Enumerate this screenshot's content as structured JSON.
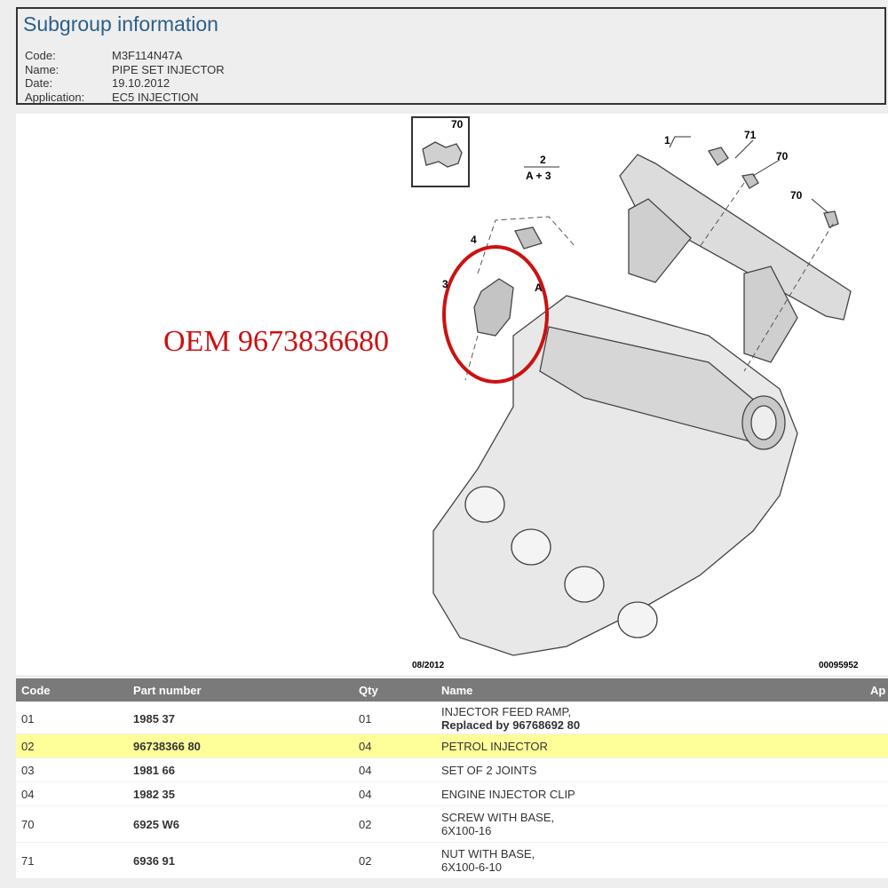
{
  "subgroup": {
    "title": "Subgroup information",
    "fields": [
      {
        "label": "Code:",
        "value": "M3F114N47A"
      },
      {
        "label": "Name:",
        "value": "PIPE SET INJECTOR"
      },
      {
        "label": "Date:",
        "value": "19.10.2012"
      },
      {
        "label": "Application:",
        "value": "EC5 INJECTION"
      }
    ]
  },
  "diagram": {
    "date_label": "08/2012",
    "ref_label": "00095952",
    "oem_annotation": "OEM 9673836680",
    "callouts": {
      "c1": "1",
      "c2": "2",
      "c2b": "A + 3",
      "c3": "3",
      "c4": "4",
      "cA": "A",
      "c70a": "70",
      "c70b": "70",
      "c70c": "70",
      "c71": "71"
    },
    "highlight_color": "#cc1111"
  },
  "table": {
    "headers": {
      "code": "Code",
      "part": "Part number",
      "qty": "Qty",
      "name": "Name",
      "app": "Ap"
    },
    "rows": [
      {
        "code": "01",
        "part": "1985 37",
        "qty": "01",
        "name": "INJECTOR FEED RAMP,",
        "name2": "Replaced by 96768692 80"
      },
      {
        "code": "02",
        "part": "96738366 80",
        "qty": "04",
        "name": "PETROL INJECTOR",
        "name2": ""
      },
      {
        "code": "03",
        "part": "1981 66",
        "qty": "04",
        "name": "SET OF 2 JOINTS",
        "name2": ""
      },
      {
        "code": "04",
        "part": "1982 35",
        "qty": "04",
        "name": "ENGINE INJECTOR CLIP",
        "name2": ""
      },
      {
        "code": "70",
        "part": "6925 W6",
        "qty": "02",
        "name": "SCREW WITH BASE,",
        "name2": "6X100-16"
      },
      {
        "code": "71",
        "part": "6936 91",
        "qty": "02",
        "name": "NUT WITH BASE,",
        "name2": "6X100-6-10"
      }
    ],
    "highlight_row": "#ffff99"
  }
}
